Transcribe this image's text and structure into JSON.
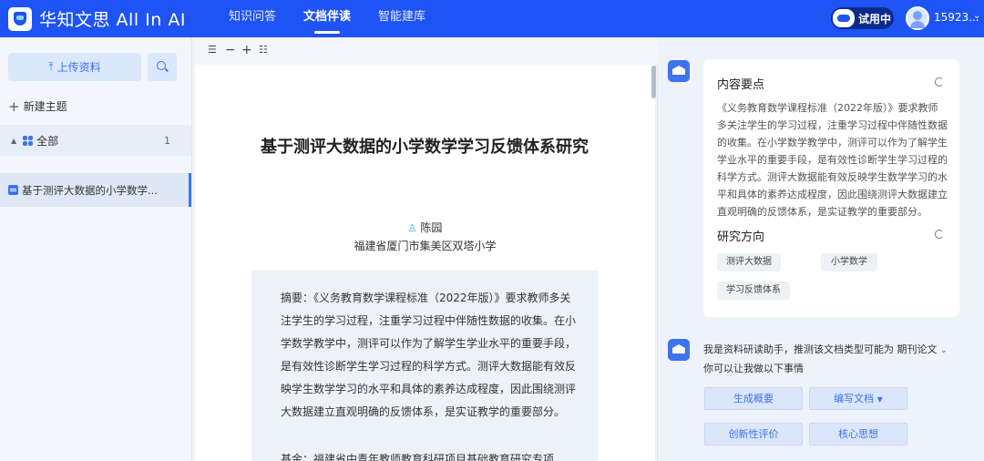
{
  "header": {
    "brand": "华知文思 All In AI",
    "nav": [
      "知识问答",
      "文档伴读",
      "智能建库"
    ],
    "trial_label": "试用中",
    "user_name": "15923...",
    "user_caret": "⌄"
  },
  "sidebar": {
    "upload_label": "上传资料",
    "new_topic_label": "新建主题",
    "all_label": "全部",
    "all_count": "1",
    "doc_title": "基于测评大数据的小学数学..."
  },
  "document": {
    "title": "基于测评大数据的小学数学学习反馈体系研究",
    "author": "陈园",
    "affiliation": "福建省厦门市集美区双塔小学",
    "abstract": "摘要：《义务教育数学课程标准（2022年版）》要求教师多关注学生的学习过程，注重学习过程中伴随性数据的收集。在小学数学教学中，测评可以作为了解学生学业水平的重要手段，是有效性诊断学生学习过程的科学方式。测评大数据能有效反映学生数学学习的水平和具体的素养达成程度，因此围绕测评大数据建立直观明确的反馈体系，是实证教学的重要部分。",
    "fund": "基金：福建省中青年教师教育科研项目基础教育研究专项"
  },
  "right_panel": {
    "summary_heading": "内容要点",
    "summary": "《义务教育数学课程标准（2022年版）》要求教师多关注学生的学习过程，注重学习过程中伴随性数据的收集。在小学数学教学中，测评可以作为了解学生学业水平的重要手段，是有效性诊断学生学习过程的科学方式。测评大数据能有效反映学生数学学习的水平和具体的素养达成程度，因此围绕测评大数据建立直观明确的反馈体系，是实证教学的重要部分。",
    "direction_heading": "研究方向",
    "tags": [
      "测评大数据",
      "小学数学",
      "学习反馈体系"
    ],
    "intro_prefix": "我是资料研读助手，推测该文档类型可能为",
    "intro_type": "期刊论文",
    "intro_suffix": "你可以让我做以下事情",
    "actions": [
      "生成概要",
      "编写文档",
      "创新性评价",
      "核心思想"
    ]
  },
  "colors": {
    "primary": "#1e53f5",
    "accent": "#3d73ec"
  }
}
